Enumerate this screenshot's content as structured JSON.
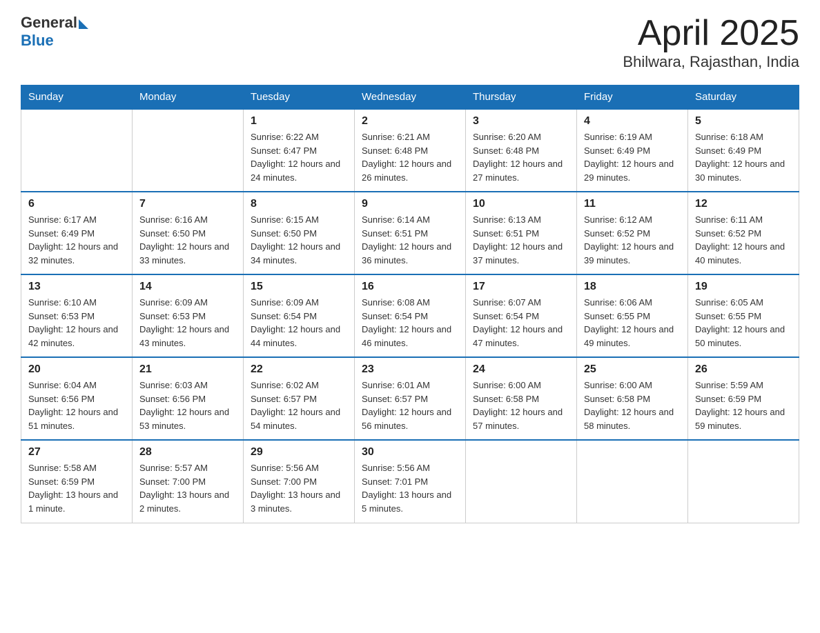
{
  "logo": {
    "text_general": "General",
    "text_blue": "Blue"
  },
  "header": {
    "month": "April 2025",
    "location": "Bhilwara, Rajasthan, India"
  },
  "weekdays": [
    "Sunday",
    "Monday",
    "Tuesday",
    "Wednesday",
    "Thursday",
    "Friday",
    "Saturday"
  ],
  "weeks": [
    [
      {
        "day": "",
        "sunrise": "",
        "sunset": "",
        "daylight": ""
      },
      {
        "day": "",
        "sunrise": "",
        "sunset": "",
        "daylight": ""
      },
      {
        "day": "1",
        "sunrise": "Sunrise: 6:22 AM",
        "sunset": "Sunset: 6:47 PM",
        "daylight": "Daylight: 12 hours and 24 minutes."
      },
      {
        "day": "2",
        "sunrise": "Sunrise: 6:21 AM",
        "sunset": "Sunset: 6:48 PM",
        "daylight": "Daylight: 12 hours and 26 minutes."
      },
      {
        "day": "3",
        "sunrise": "Sunrise: 6:20 AM",
        "sunset": "Sunset: 6:48 PM",
        "daylight": "Daylight: 12 hours and 27 minutes."
      },
      {
        "day": "4",
        "sunrise": "Sunrise: 6:19 AM",
        "sunset": "Sunset: 6:49 PM",
        "daylight": "Daylight: 12 hours and 29 minutes."
      },
      {
        "day": "5",
        "sunrise": "Sunrise: 6:18 AM",
        "sunset": "Sunset: 6:49 PM",
        "daylight": "Daylight: 12 hours and 30 minutes."
      }
    ],
    [
      {
        "day": "6",
        "sunrise": "Sunrise: 6:17 AM",
        "sunset": "Sunset: 6:49 PM",
        "daylight": "Daylight: 12 hours and 32 minutes."
      },
      {
        "day": "7",
        "sunrise": "Sunrise: 6:16 AM",
        "sunset": "Sunset: 6:50 PM",
        "daylight": "Daylight: 12 hours and 33 minutes."
      },
      {
        "day": "8",
        "sunrise": "Sunrise: 6:15 AM",
        "sunset": "Sunset: 6:50 PM",
        "daylight": "Daylight: 12 hours and 34 minutes."
      },
      {
        "day": "9",
        "sunrise": "Sunrise: 6:14 AM",
        "sunset": "Sunset: 6:51 PM",
        "daylight": "Daylight: 12 hours and 36 minutes."
      },
      {
        "day": "10",
        "sunrise": "Sunrise: 6:13 AM",
        "sunset": "Sunset: 6:51 PM",
        "daylight": "Daylight: 12 hours and 37 minutes."
      },
      {
        "day": "11",
        "sunrise": "Sunrise: 6:12 AM",
        "sunset": "Sunset: 6:52 PM",
        "daylight": "Daylight: 12 hours and 39 minutes."
      },
      {
        "day": "12",
        "sunrise": "Sunrise: 6:11 AM",
        "sunset": "Sunset: 6:52 PM",
        "daylight": "Daylight: 12 hours and 40 minutes."
      }
    ],
    [
      {
        "day": "13",
        "sunrise": "Sunrise: 6:10 AM",
        "sunset": "Sunset: 6:53 PM",
        "daylight": "Daylight: 12 hours and 42 minutes."
      },
      {
        "day": "14",
        "sunrise": "Sunrise: 6:09 AM",
        "sunset": "Sunset: 6:53 PM",
        "daylight": "Daylight: 12 hours and 43 minutes."
      },
      {
        "day": "15",
        "sunrise": "Sunrise: 6:09 AM",
        "sunset": "Sunset: 6:54 PM",
        "daylight": "Daylight: 12 hours and 44 minutes."
      },
      {
        "day": "16",
        "sunrise": "Sunrise: 6:08 AM",
        "sunset": "Sunset: 6:54 PM",
        "daylight": "Daylight: 12 hours and 46 minutes."
      },
      {
        "day": "17",
        "sunrise": "Sunrise: 6:07 AM",
        "sunset": "Sunset: 6:54 PM",
        "daylight": "Daylight: 12 hours and 47 minutes."
      },
      {
        "day": "18",
        "sunrise": "Sunrise: 6:06 AM",
        "sunset": "Sunset: 6:55 PM",
        "daylight": "Daylight: 12 hours and 49 minutes."
      },
      {
        "day": "19",
        "sunrise": "Sunrise: 6:05 AM",
        "sunset": "Sunset: 6:55 PM",
        "daylight": "Daylight: 12 hours and 50 minutes."
      }
    ],
    [
      {
        "day": "20",
        "sunrise": "Sunrise: 6:04 AM",
        "sunset": "Sunset: 6:56 PM",
        "daylight": "Daylight: 12 hours and 51 minutes."
      },
      {
        "day": "21",
        "sunrise": "Sunrise: 6:03 AM",
        "sunset": "Sunset: 6:56 PM",
        "daylight": "Daylight: 12 hours and 53 minutes."
      },
      {
        "day": "22",
        "sunrise": "Sunrise: 6:02 AM",
        "sunset": "Sunset: 6:57 PM",
        "daylight": "Daylight: 12 hours and 54 minutes."
      },
      {
        "day": "23",
        "sunrise": "Sunrise: 6:01 AM",
        "sunset": "Sunset: 6:57 PM",
        "daylight": "Daylight: 12 hours and 56 minutes."
      },
      {
        "day": "24",
        "sunrise": "Sunrise: 6:00 AM",
        "sunset": "Sunset: 6:58 PM",
        "daylight": "Daylight: 12 hours and 57 minutes."
      },
      {
        "day": "25",
        "sunrise": "Sunrise: 6:00 AM",
        "sunset": "Sunset: 6:58 PM",
        "daylight": "Daylight: 12 hours and 58 minutes."
      },
      {
        "day": "26",
        "sunrise": "Sunrise: 5:59 AM",
        "sunset": "Sunset: 6:59 PM",
        "daylight": "Daylight: 12 hours and 59 minutes."
      }
    ],
    [
      {
        "day": "27",
        "sunrise": "Sunrise: 5:58 AM",
        "sunset": "Sunset: 6:59 PM",
        "daylight": "Daylight: 13 hours and 1 minute."
      },
      {
        "day": "28",
        "sunrise": "Sunrise: 5:57 AM",
        "sunset": "Sunset: 7:00 PM",
        "daylight": "Daylight: 13 hours and 2 minutes."
      },
      {
        "day": "29",
        "sunrise": "Sunrise: 5:56 AM",
        "sunset": "Sunset: 7:00 PM",
        "daylight": "Daylight: 13 hours and 3 minutes."
      },
      {
        "day": "30",
        "sunrise": "Sunrise: 5:56 AM",
        "sunset": "Sunset: 7:01 PM",
        "daylight": "Daylight: 13 hours and 5 minutes."
      },
      {
        "day": "",
        "sunrise": "",
        "sunset": "",
        "daylight": ""
      },
      {
        "day": "",
        "sunrise": "",
        "sunset": "",
        "daylight": ""
      },
      {
        "day": "",
        "sunrise": "",
        "sunset": "",
        "daylight": ""
      }
    ]
  ]
}
